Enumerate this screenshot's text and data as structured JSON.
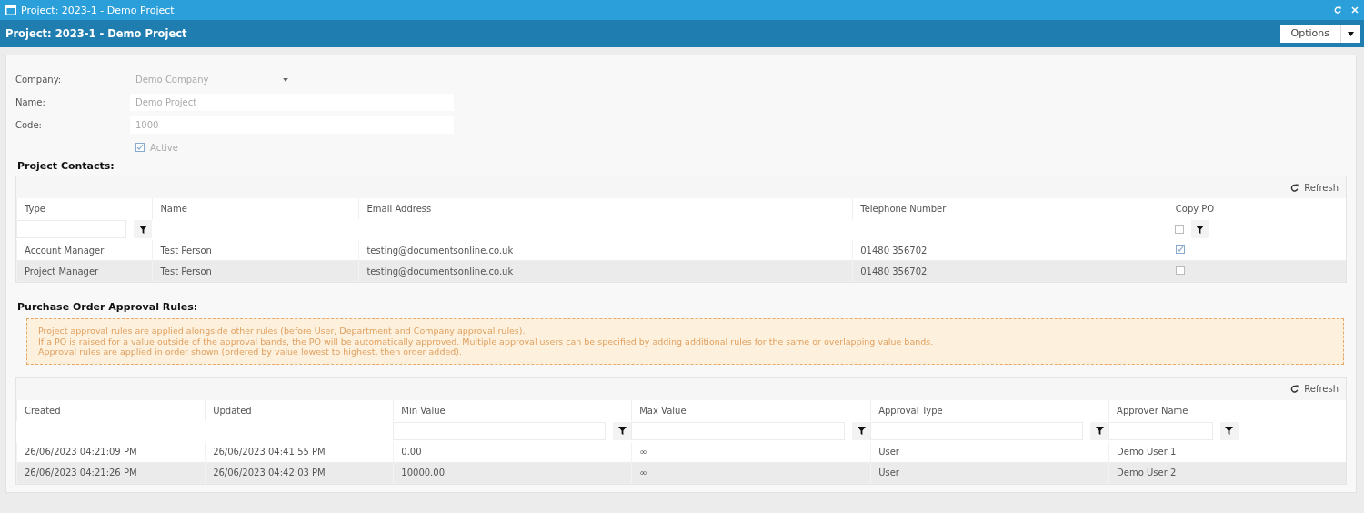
{
  "window": {
    "title": "Project: 2023-1 - Demo Project"
  },
  "header": {
    "title": "Project: 2023-1 - Demo Project",
    "options_button": "Options"
  },
  "form": {
    "fields": [
      {
        "label": "Company:",
        "kind": "dropdown",
        "value": "Demo Company"
      },
      {
        "label": "Name:",
        "kind": "text",
        "value": "Demo Project"
      },
      {
        "label": "Code:",
        "kind": "text",
        "value": "1000"
      }
    ],
    "active": {
      "label": "Active",
      "checked": true
    }
  },
  "contacts": {
    "title": "Project Contacts:",
    "refresh": "Refresh",
    "columns": [
      {
        "label": "Type",
        "filter": {
          "kind": "text"
        }
      },
      {
        "label": "Name"
      },
      {
        "label": "Email Address"
      },
      {
        "label": "Telephone Number"
      },
      {
        "label": "Copy PO",
        "filter": {
          "kind": "checkbox",
          "checked": false
        }
      }
    ],
    "rows": [
      {
        "cells": [
          "Account Manager",
          "Test Person",
          "testing@documentsonline.co.uk",
          "01480 356702"
        ],
        "copy_po": true
      },
      {
        "cells": [
          "Project Manager",
          "Test Person",
          "testing@documentsonline.co.uk",
          "01480 356702"
        ],
        "copy_po": false
      }
    ]
  },
  "approval_rules": {
    "title": "Purchase Order Approval Rules:",
    "notice": [
      "Project approval rules are applied alongside other rules (before User, Department and Company approval rules).",
      "If a PO is raised for a value outside of the approval bands, the PO will be automatically approved. Multiple approval users can be specified by adding additional rules for the same or overlapping value bands.",
      "Approval rules are applied in order shown (ordered by value lowest to highest, then order added)."
    ],
    "refresh": "Refresh",
    "columns": [
      {
        "label": "Created"
      },
      {
        "label": "Updated"
      },
      {
        "label": "Min Value",
        "filter": {
          "kind": "text"
        }
      },
      {
        "label": "Max Value",
        "filter": {
          "kind": "text"
        }
      },
      {
        "label": "Approval Type",
        "filter": {
          "kind": "text"
        }
      },
      {
        "label": "Approver Name",
        "filter": {
          "kind": "text"
        }
      }
    ],
    "rows": [
      {
        "cells": [
          "26/06/2023 04:21:09 PM",
          "26/06/2023 04:41:55 PM",
          "0.00",
          "∞",
          "User",
          "Demo User 1"
        ]
      },
      {
        "cells": [
          "26/06/2023 04:21:26 PM",
          "26/06/2023 04:42:03 PM",
          "10000.00",
          "∞",
          "User",
          "Demo User 2"
        ]
      }
    ]
  }
}
